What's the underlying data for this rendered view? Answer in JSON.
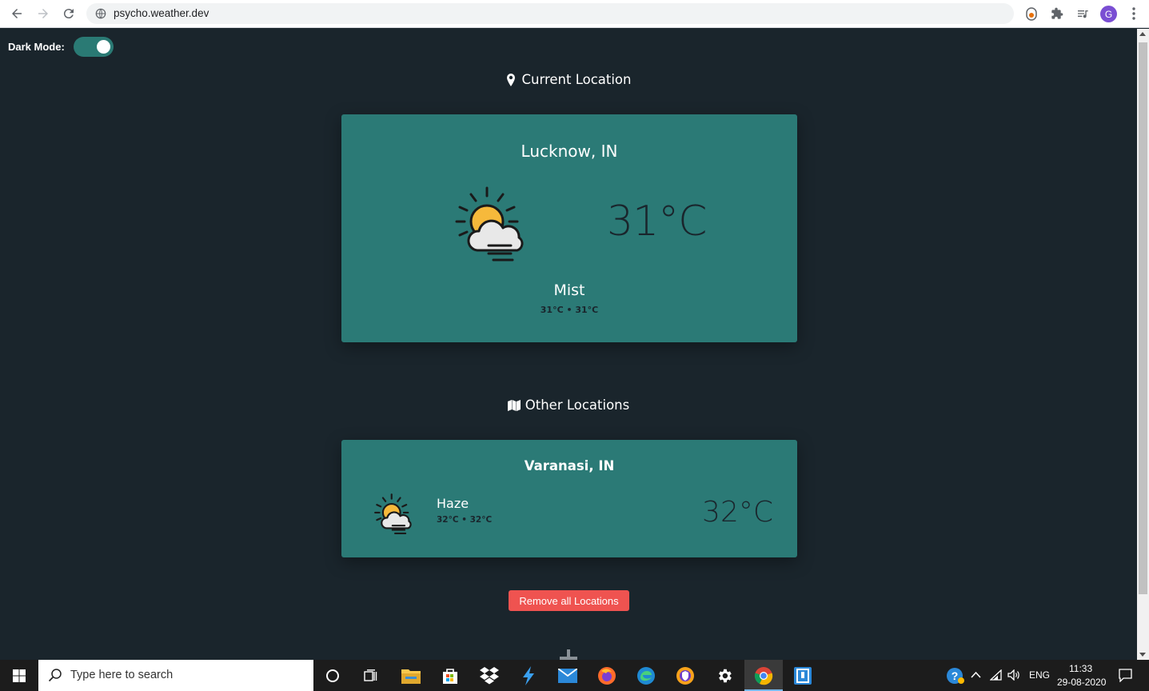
{
  "browser": {
    "url": "psycho.weather.dev",
    "avatar_initial": "G"
  },
  "page": {
    "dark_mode_label": "Dark Mode:",
    "dark_mode_on": true,
    "current_section_title": "Current Location",
    "other_section_title": "Other Locations",
    "remove_all_label": "Remove all Locations"
  },
  "current": {
    "city": "Lucknow, IN",
    "temp": "31°C",
    "condition": "Mist",
    "range": "31°C • 31°C",
    "icon": "sun-cloud-mist-icon"
  },
  "others": [
    {
      "city": "Varanasi, IN",
      "condition": "Haze",
      "range": "32°C • 32°C",
      "temp": "32°C",
      "icon": "sun-cloud-haze-icon"
    }
  ],
  "taskbar": {
    "search_placeholder": "Type here to search",
    "language": "ENG",
    "time": "11:33",
    "date": "29-08-2020"
  },
  "colors": {
    "page_bg": "#1a252c",
    "card_bg": "#2b7a76",
    "button_red": "#ef5350",
    "toggle_on": "#2a7a74"
  }
}
